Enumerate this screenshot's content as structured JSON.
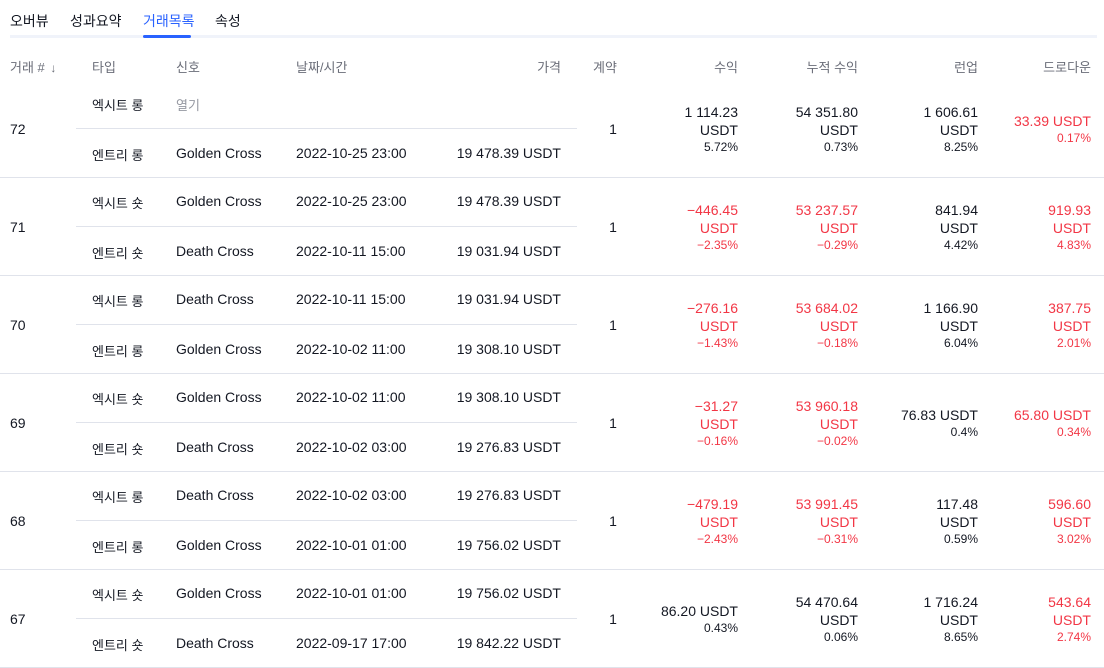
{
  "tabs": [
    "오버뷰",
    "성과요약",
    "거래목록",
    "속성"
  ],
  "active_tab": 2,
  "headers": {
    "trade_no": "거래 #",
    "sort_arrow": "↓",
    "type": "타입",
    "signal": "신호",
    "datetime": "날짜/시간",
    "price": "가격",
    "contracts": "계약",
    "profit": "수익",
    "cum_profit": "누적 수익",
    "runup": "런업",
    "drawdown": "드로다운"
  },
  "trades": [
    {
      "no": "72",
      "exit": {
        "type": "엑시트 롱",
        "signal": "열기",
        "datetime": "",
        "price": ""
      },
      "entry": {
        "type": "엔트리 롱",
        "signal": "Golden Cross",
        "datetime": "2022-10-25 23:00",
        "price": "19 478.39 USDT"
      },
      "contracts": "1",
      "profit": {
        "l1": "1 114.23",
        "l2": "USDT",
        "pct": "5.72%",
        "neg": false
      },
      "cum": {
        "l1": "54 351.80",
        "l2": "USDT",
        "pct": "0.73%",
        "neg": false
      },
      "runup": {
        "l1": "1 606.61",
        "l2": "USDT",
        "pct": "8.25%"
      },
      "dd": {
        "l1": "33.39 USDT",
        "l2": "",
        "pct": "0.17%"
      }
    },
    {
      "no": "71",
      "exit": {
        "type": "엑시트 숏",
        "signal": "Golden Cross",
        "datetime": "2022-10-25 23:00",
        "price": "19 478.39 USDT"
      },
      "entry": {
        "type": "엔트리 숏",
        "signal": "Death Cross",
        "datetime": "2022-10-11 15:00",
        "price": "19 031.94 USDT"
      },
      "contracts": "1",
      "profit": {
        "l1": "−446.45",
        "l2": "USDT",
        "pct": "−2.35%",
        "neg": true
      },
      "cum": {
        "l1": "53 237.57",
        "l2": "USDT",
        "pct": "−0.29%",
        "neg": true
      },
      "runup": {
        "l1": "841.94",
        "l2": "USDT",
        "pct": "4.42%"
      },
      "dd": {
        "l1": "919.93",
        "l2": "USDT",
        "pct": "4.83%"
      }
    },
    {
      "no": "70",
      "exit": {
        "type": "엑시트 롱",
        "signal": "Death Cross",
        "datetime": "2022-10-11 15:00",
        "price": "19 031.94 USDT"
      },
      "entry": {
        "type": "엔트리 롱",
        "signal": "Golden Cross",
        "datetime": "2022-10-02 11:00",
        "price": "19 308.10 USDT"
      },
      "contracts": "1",
      "profit": {
        "l1": "−276.16",
        "l2": "USDT",
        "pct": "−1.43%",
        "neg": true
      },
      "cum": {
        "l1": "53 684.02",
        "l2": "USDT",
        "pct": "−0.18%",
        "neg": true
      },
      "runup": {
        "l1": "1 166.90",
        "l2": "USDT",
        "pct": "6.04%"
      },
      "dd": {
        "l1": "387.75",
        "l2": "USDT",
        "pct": "2.01%"
      }
    },
    {
      "no": "69",
      "exit": {
        "type": "엑시트 숏",
        "signal": "Golden Cross",
        "datetime": "2022-10-02 11:00",
        "price": "19 308.10 USDT"
      },
      "entry": {
        "type": "엔트리 숏",
        "signal": "Death Cross",
        "datetime": "2022-10-02 03:00",
        "price": "19 276.83 USDT"
      },
      "contracts": "1",
      "profit": {
        "l1": "−31.27",
        "l2": "USDT",
        "pct": "−0.16%",
        "neg": true
      },
      "cum": {
        "l1": "53 960.18",
        "l2": "USDT",
        "pct": "−0.02%",
        "neg": true
      },
      "runup": {
        "l1": "76.83 USDT",
        "l2": "",
        "pct": "0.4%"
      },
      "dd": {
        "l1": "65.80 USDT",
        "l2": "",
        "pct": "0.34%"
      }
    },
    {
      "no": "68",
      "exit": {
        "type": "엑시트 롱",
        "signal": "Death Cross",
        "datetime": "2022-10-02 03:00",
        "price": "19 276.83 USDT"
      },
      "entry": {
        "type": "엔트리 롱",
        "signal": "Golden Cross",
        "datetime": "2022-10-01 01:00",
        "price": "19 756.02 USDT"
      },
      "contracts": "1",
      "profit": {
        "l1": "−479.19",
        "l2": "USDT",
        "pct": "−2.43%",
        "neg": true
      },
      "cum": {
        "l1": "53 991.45",
        "l2": "USDT",
        "pct": "−0.31%",
        "neg": true
      },
      "runup": {
        "l1": "117.48",
        "l2": "USDT",
        "pct": "0.59%"
      },
      "dd": {
        "l1": "596.60",
        "l2": "USDT",
        "pct": "3.02%"
      }
    },
    {
      "no": "67",
      "exit": {
        "type": "엑시트 숏",
        "signal": "Golden Cross",
        "datetime": "2022-10-01 01:00",
        "price": "19 756.02 USDT"
      },
      "entry": {
        "type": "엔트리 숏",
        "signal": "Death Cross",
        "datetime": "2022-09-17 17:00",
        "price": "19 842.22 USDT"
      },
      "contracts": "1",
      "profit": {
        "l1": "86.20 USDT",
        "l2": "",
        "pct": "0.43%",
        "neg": false
      },
      "cum": {
        "l1": "54 470.64",
        "l2": "USDT",
        "pct": "0.06%",
        "neg": false
      },
      "runup": {
        "l1": "1 716.24",
        "l2": "USDT",
        "pct": "8.65%"
      },
      "dd": {
        "l1": "543.64",
        "l2": "USDT",
        "pct": "2.74%"
      }
    }
  ],
  "colors": {
    "accent": "#2962ff",
    "negative": "#f23645",
    "text": "#131722",
    "muted": "#6a6d78"
  }
}
